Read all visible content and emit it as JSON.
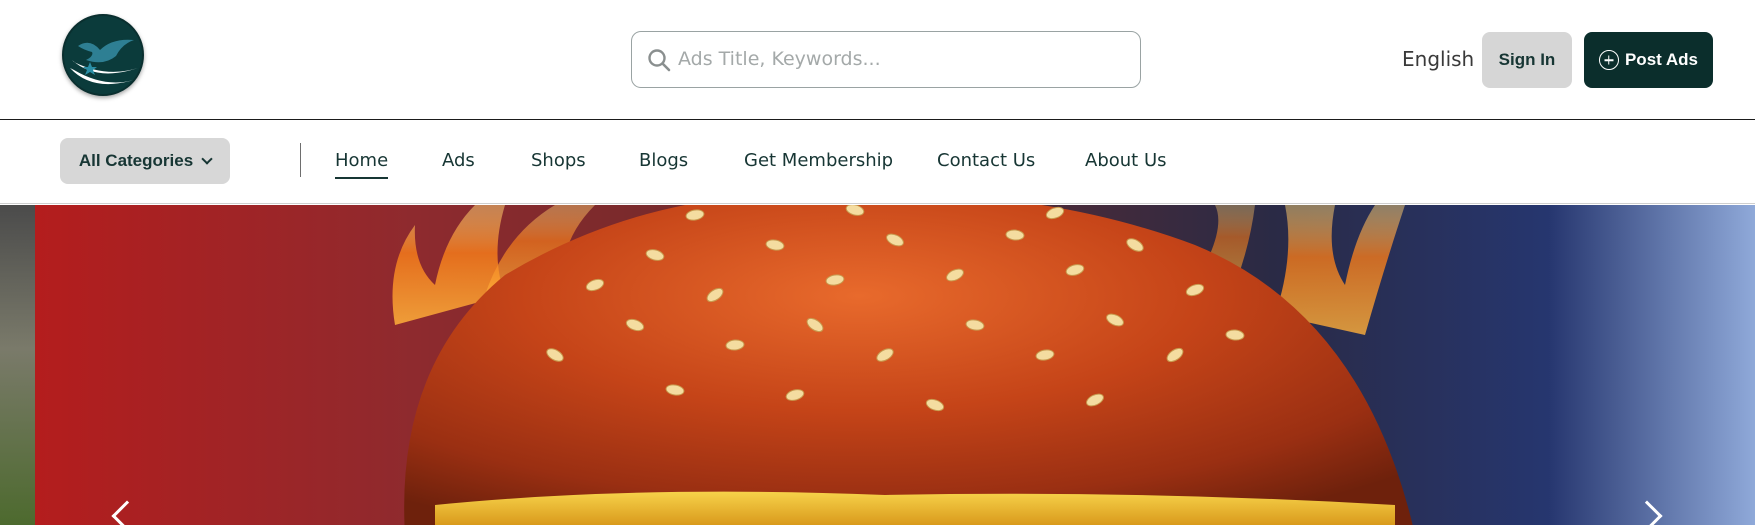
{
  "header": {
    "logo_icon": "dove-logo-icon",
    "search": {
      "placeholder": "Ads Title, Keywords...",
      "value": "",
      "icon": "search-icon"
    },
    "language": "English",
    "sign_in_label": "Sign In",
    "post_ads_label": "Post Ads",
    "post_ads_icon": "plus-circle-icon"
  },
  "nav": {
    "categories_label": "All Categories",
    "items": [
      {
        "label": "Home",
        "active": true
      },
      {
        "label": "Ads"
      },
      {
        "label": "Shops"
      },
      {
        "label": "Blogs"
      },
      {
        "label": "Get Membership"
      },
      {
        "label": "Contact Us"
      },
      {
        "label": "About Us"
      }
    ]
  },
  "hero": {
    "image_subject": "burger-with-flames",
    "prev_icon": "chevron-left-icon",
    "next_icon": "chevron-right-icon"
  },
  "colors": {
    "brand_dark": "#0b2e2c",
    "text_dark": "#173634",
    "button_gray": "#d6d6d6",
    "search_border": "#9aa3a3"
  }
}
